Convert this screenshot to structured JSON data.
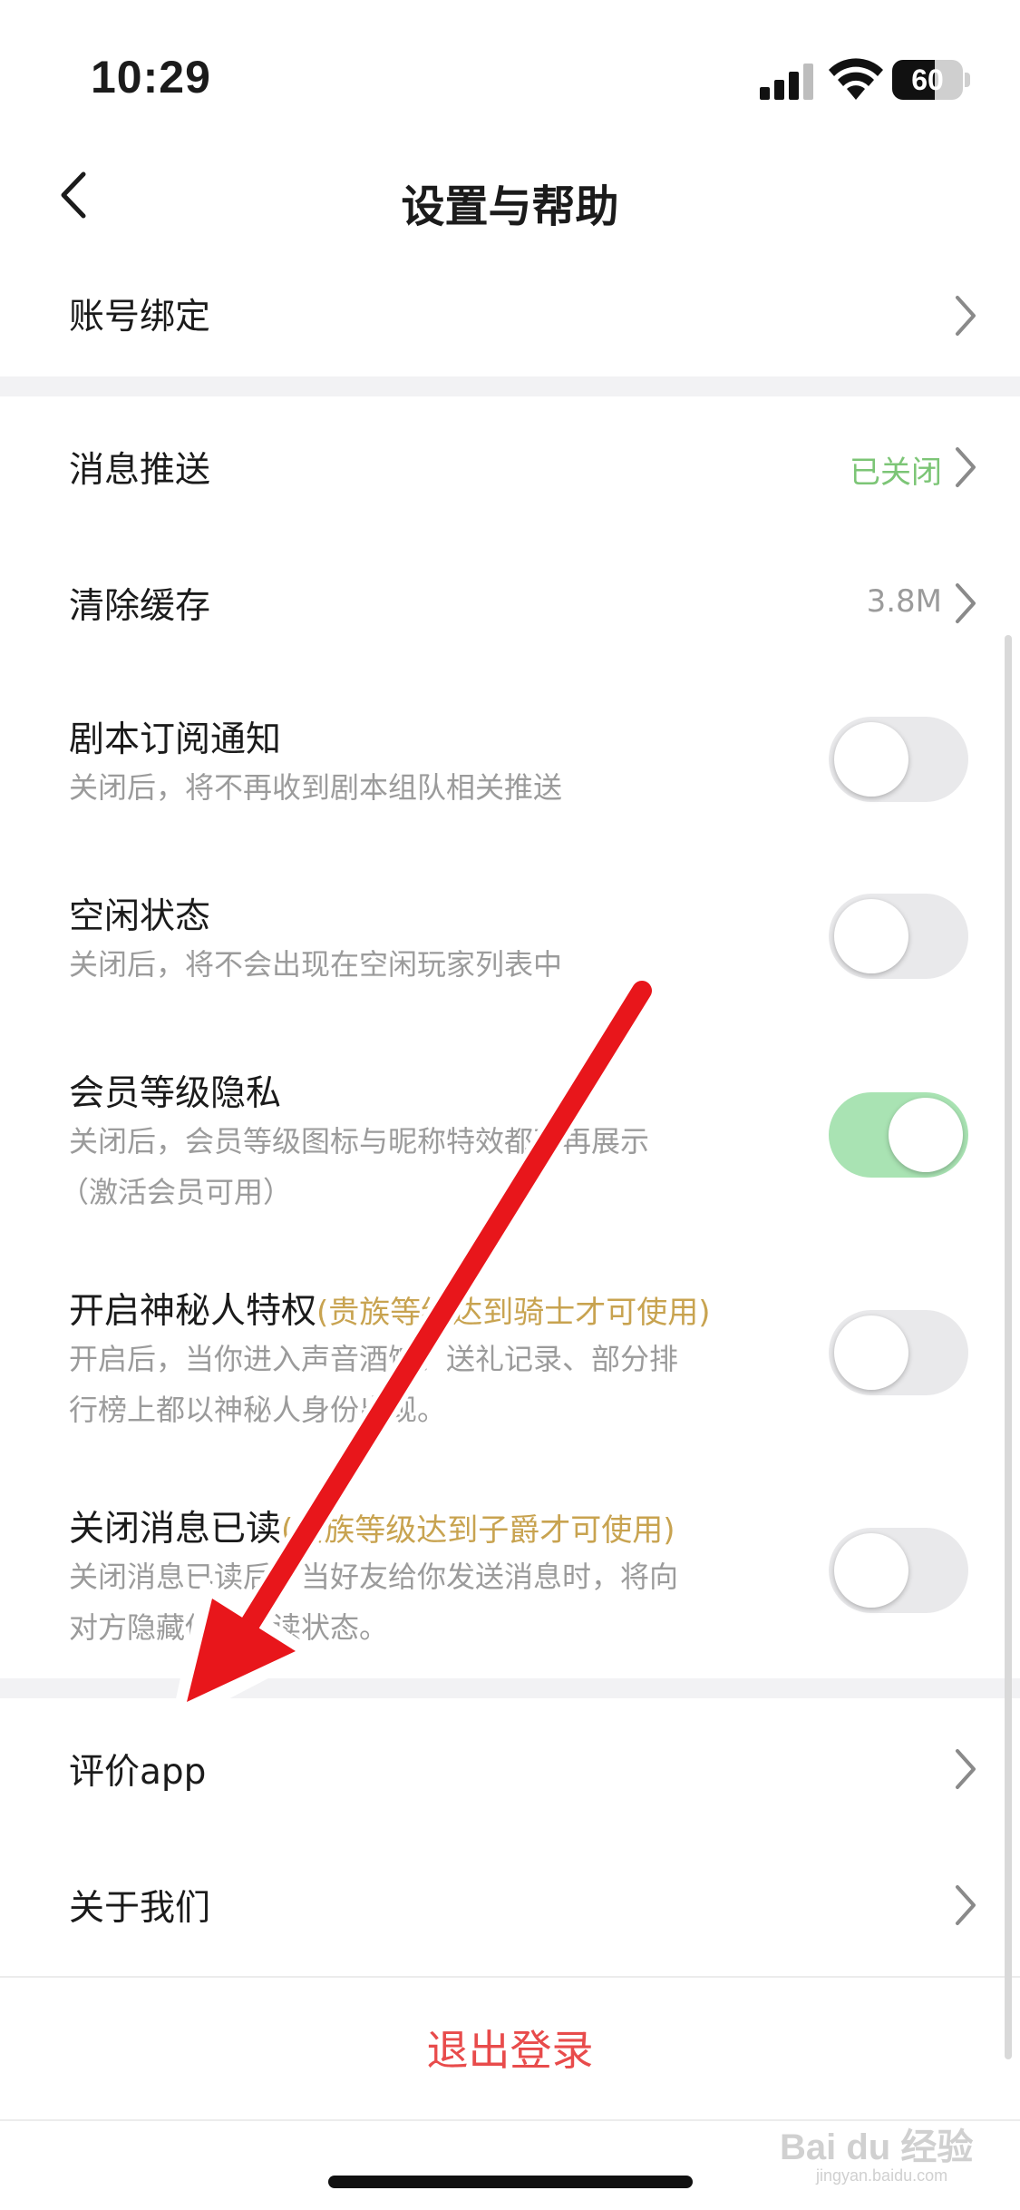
{
  "status_bar": {
    "time": "10:29",
    "battery": "60",
    "battery_level": 0.6
  },
  "nav": {
    "title": "设置与帮助"
  },
  "rows": {
    "account_binding": {
      "title": "账号绑定"
    },
    "push": {
      "title": "消息推送",
      "value": "已关闭",
      "value_color": "#7cc576"
    },
    "cache": {
      "title": "清除缓存",
      "value": "3.8M",
      "value_color": "#9b9b9b"
    },
    "script_notify": {
      "title": "剧本订阅通知",
      "subtitle": "关闭后，将不再收到剧本组队相关推送",
      "toggle": false
    },
    "idle": {
      "title": "空闲状态",
      "subtitle": "关闭后，将不会出现在空闲玩家列表中",
      "toggle": false
    },
    "member_privacy": {
      "title": "会员等级隐私",
      "subtitle_1": "关闭后，会员等级图标与昵称特效都不再展示",
      "subtitle_2": "（激活会员可用）",
      "toggle": true
    },
    "mystery": {
      "title": "开启神秘人特权",
      "note": "(贵族等级达到骑士才可使用)",
      "subtitle_1": "开启后，当你进入声音酒馆、送礼记录、部分排",
      "subtitle_2": "行榜上都以神秘人身份出现。",
      "toggle": false
    },
    "read_receipt": {
      "title": "关闭消息已读",
      "note": "(贵族等级达到子爵才可使用)",
      "subtitle_1": "关闭消息已读后，当好友给你发送消息时，将向",
      "subtitle_2": "对方隐藏你的已读状态。",
      "toggle": false
    },
    "rate_app": {
      "title": "评价app"
    },
    "about": {
      "title": "关于我们"
    }
  },
  "logout": {
    "label": "退出登录"
  },
  "watermark": {
    "text": "Bai du 经验",
    "sub": "jingyan.baidu.com"
  },
  "colors": {
    "accent_red": "#e84b4b",
    "toggle_on": "#a9e3b3",
    "gold": "#c8a350",
    "arrow": "#e8161b"
  },
  "icons": [
    "back-chevron-icon",
    "chevron-right-icon",
    "signal-icon",
    "wifi-icon",
    "battery-icon"
  ]
}
